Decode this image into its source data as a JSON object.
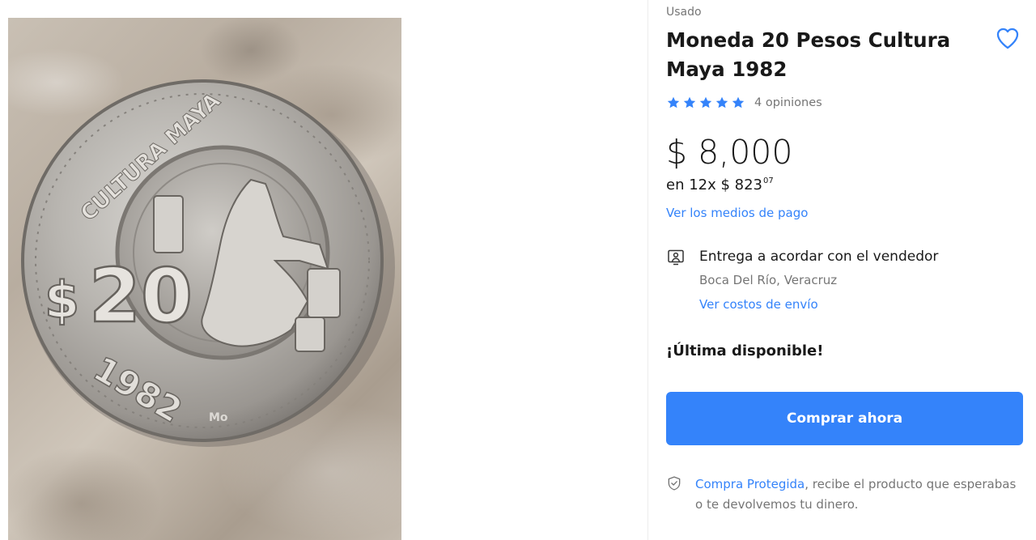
{
  "product": {
    "condition": "Usado",
    "title": "Moneda 20 Pesos Cultura Maya 1982",
    "rating": {
      "stars": 5,
      "reviews_label": "4 opiniones"
    },
    "price": {
      "currency": "$",
      "amount": "8,000"
    },
    "installments": {
      "prefix": "en 12x $ 823",
      "cents": "07"
    },
    "payment_link": "Ver los medios de pago",
    "stock_label": "¡Última disponible!"
  },
  "delivery": {
    "title": "Entrega a acordar con el vendedor",
    "location": "Boca Del Río, Veracruz",
    "shipping_link": "Ver costos de envío"
  },
  "actions": {
    "buy_now": "Comprar ahora"
  },
  "protection": {
    "link": "Compra Protegida",
    "text": ", recibe el producto que esperabas o te devolvemos tu dinero."
  },
  "coin": {
    "legend": "CULTURA MAYA",
    "currency_sign": "$",
    "denomination": "20",
    "year": "1982",
    "mint_mark": "Mo"
  },
  "colors": {
    "accent": "#3483fa",
    "text_primary": "#1a1a1a",
    "text_secondary": "#737373"
  },
  "icons": {
    "favorite": "heart-icon",
    "star": "star-icon",
    "delivery": "pickup-person-icon",
    "protection": "shield-check-icon"
  }
}
